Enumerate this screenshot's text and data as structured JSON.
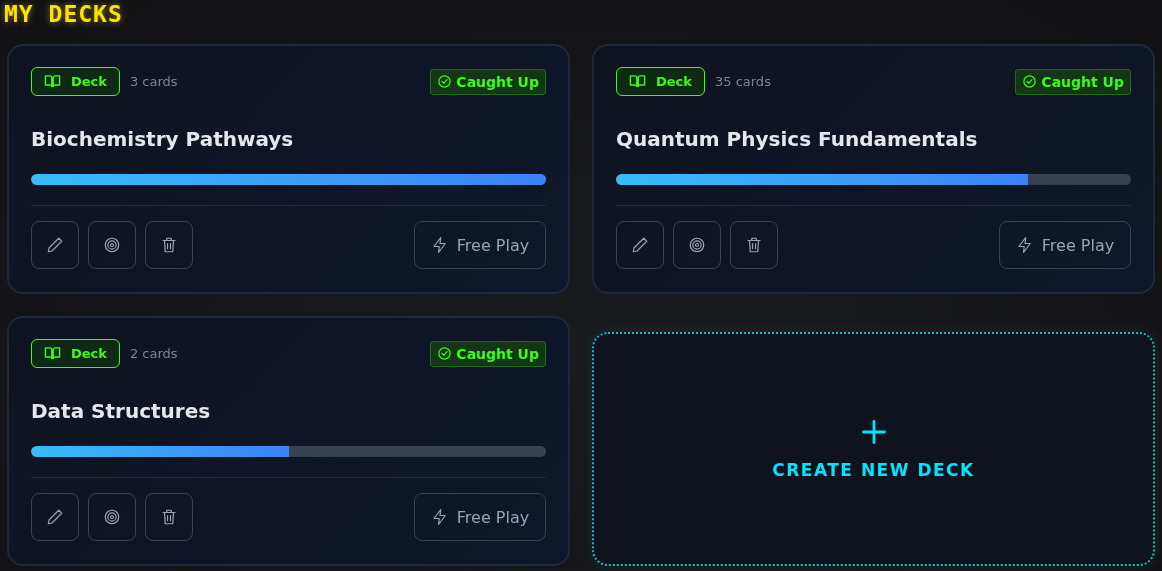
{
  "heading": "MY DECKS",
  "decks": [
    {
      "badge": "Deck",
      "count": "3 cards",
      "status": "Caught Up",
      "title": "Biochemistry Pathways",
      "level": 1.0,
      "action": "Free Play"
    },
    {
      "badge": "Deck",
      "count": "35 cards",
      "status": "Caught Up",
      "title": "Quantum Physics Fundamentals",
      "level": 0.8,
      "action": "Free Play"
    },
    {
      "badge": "Deck",
      "count": "2 cards",
      "status": "Caught Up",
      "title": "Data Structures",
      "level": 0.5,
      "action": "Free Play"
    }
  ],
  "create": {
    "label": "CREATE NEW DECK"
  }
}
